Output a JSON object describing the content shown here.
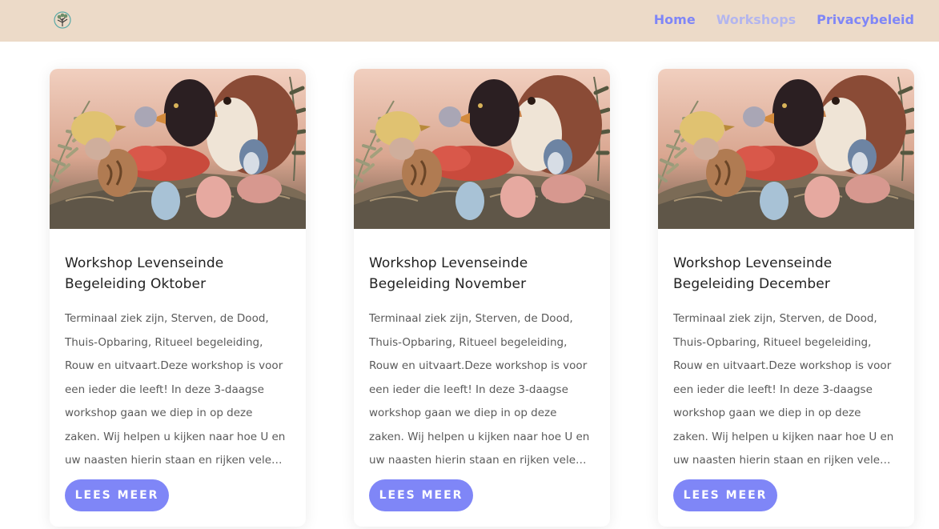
{
  "nav": {
    "logo_icon": "tree-logo-icon",
    "links": [
      {
        "label": "Home",
        "active": false
      },
      {
        "label": "Workshops",
        "active": true
      },
      {
        "label": "Privacybeleid",
        "active": false
      }
    ]
  },
  "colors": {
    "navbar_bg": "#ecdac8",
    "accent": "#7f86f7",
    "active_link": "#b3b5ee"
  },
  "cards": [
    {
      "image": "birds-painting-image",
      "title": "Workshop Levenseinde Begeleiding Oktober",
      "excerpt": "Terminaal ziek zijn, Sterven, de Dood, Thuis-Opbaring, Ritueel begeleiding, Rouw en uitvaart.Deze workshop is voor een ieder die leeft! In deze 3-daagse workshop gaan we diep in op deze zaken. Wij helpen u kijken naar hoe U en uw naasten hierin staan en rijken vele…",
      "button_label": "LEES MEER"
    },
    {
      "image": "birds-painting-image",
      "title": "Workshop Levenseinde Begeleiding November",
      "excerpt": "Terminaal ziek zijn, Sterven, de Dood, Thuis-Opbaring, Ritueel begeleiding, Rouw en uitvaart.Deze workshop is voor een ieder die leeft! In deze 3-daagse workshop gaan we diep in op deze zaken. Wij helpen u kijken naar hoe U en uw naasten hierin staan en rijken vele…",
      "button_label": "LEES MEER"
    },
    {
      "image": "birds-painting-image",
      "title": "Workshop Levenseinde Begeleiding December",
      "excerpt": "Terminaal ziek zijn, Sterven, de Dood, Thuis-Opbaring, Ritueel begeleiding, Rouw en uitvaart.Deze workshop is voor een ieder die leeft! In deze 3-daagse workshop gaan we diep in op deze zaken. Wij helpen u kijken naar hoe U en uw naasten hierin staan en rijken vele…",
      "button_label": "LEES MEER"
    }
  ]
}
